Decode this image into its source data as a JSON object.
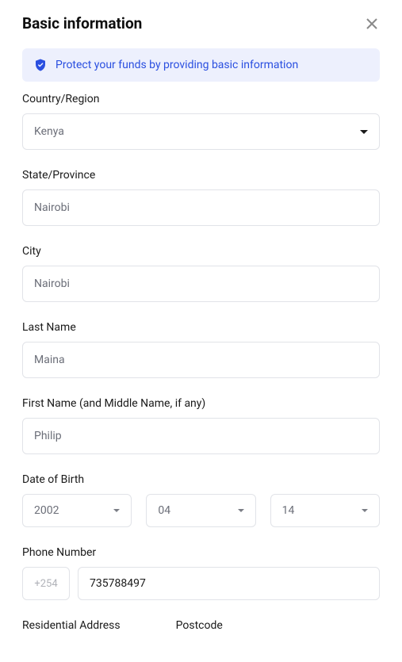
{
  "header": {
    "title": "Basic information"
  },
  "notice": {
    "text": "Protect your funds by providing basic information"
  },
  "fields": {
    "country": {
      "label": "Country/Region",
      "value": "Kenya"
    },
    "state": {
      "label": "State/Province",
      "value": "Nairobi"
    },
    "city": {
      "label": "City",
      "value": "Nairobi"
    },
    "lastName": {
      "label": "Last Name",
      "value": "Maina"
    },
    "firstName": {
      "label": "First Name (and Middle Name, if any)",
      "value": "Philip"
    },
    "dob": {
      "label": "Date of Birth",
      "year": "2002",
      "month": "04",
      "day": "14"
    },
    "phone": {
      "label": "Phone Number",
      "code": "+254",
      "value": "735788497"
    },
    "address": {
      "label": "Residential Address"
    },
    "postcode": {
      "label": "Postcode"
    }
  }
}
